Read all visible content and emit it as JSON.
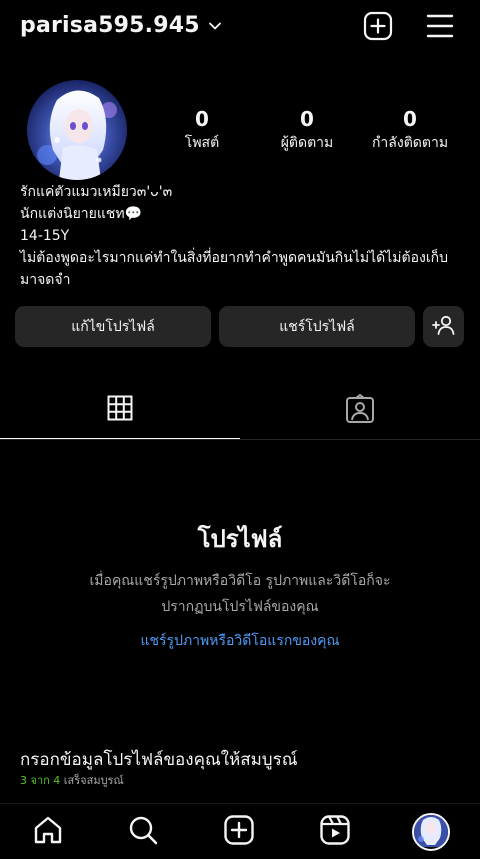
{
  "header": {
    "username": "parisa595.945",
    "chevron_icon": "chevron-down-icon",
    "create_icon": "plus-square-icon",
    "menu_icon": "hamburger-menu-icon"
  },
  "stats": {
    "posts": {
      "value": "0",
      "label": "โพสต์"
    },
    "followers": {
      "value": "0",
      "label": "ผู้ติดตาม"
    },
    "following": {
      "value": "0",
      "label": "กำลังติดตาม"
    }
  },
  "bio": {
    "line1": "รักแค่ตัวแมวเหมียว๓'ᴗ'๓",
    "line2": "นักแต่งนิยายแชท💬",
    "line3": "14-15Y",
    "line4": "ไม่ต้องพูดอะไรมากแค่ทำในสิ่งที่อยากทำคำพูดคนมันกินไม่ได้ไม่ต้องเก็บมาจดจำ"
  },
  "actions": {
    "edit_label": "แก้ไขโปรไฟล์",
    "share_label": "แชร์โปรไฟล์",
    "add_icon": "add-person-icon"
  },
  "tabs": [
    {
      "icon": "grid-icon",
      "active": true
    },
    {
      "icon": "tagged-icon",
      "active": false
    }
  ],
  "empty_state": {
    "title": "โปรไฟล์",
    "description": "เมื่อคุณแชร์รูปภาพหรือวิดีโอ รูปภาพและวิดีโอก็จะปรากฏบนโปรไฟล์ของคุณ",
    "link": "แชร์รูปภาพหรือวิดีโอแรกของคุณ"
  },
  "complete_profile": {
    "title": "กรอกข้อมูลโปรไฟล์ของคุณให้สมบูรณ์",
    "progress_done": "3 จาก 4",
    "progress_suffix": "เสร็จสมบูรณ์"
  },
  "nav": [
    "home-icon",
    "search-icon",
    "create-icon",
    "reels-icon",
    "profile-avatar"
  ],
  "colors": {
    "background": "#000000",
    "button": "#262626",
    "link": "#4f9bf5",
    "progress": "#58c322"
  }
}
